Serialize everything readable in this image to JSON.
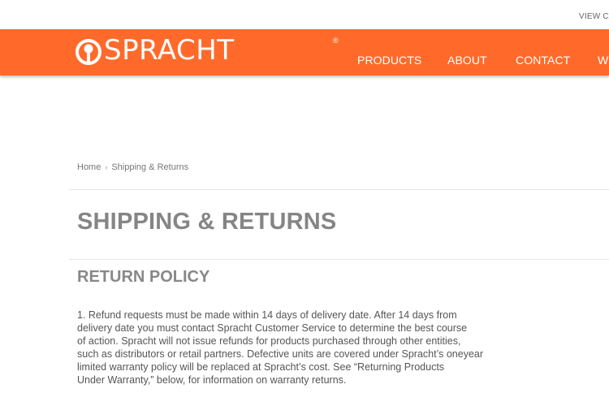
{
  "topbar": {
    "view_cart_label": "VIEW CA"
  },
  "brand": {
    "name": "SPRACHT",
    "registered_mark": "®"
  },
  "nav": {
    "items": [
      "PRODUCTS",
      "ABOUT",
      "CONTACT",
      "W"
    ]
  },
  "breadcrumb": {
    "home": "Home",
    "separator": "›",
    "current": "Shipping & Returns"
  },
  "page": {
    "title": "SHIPPING & RETURNS",
    "section_title": "RETURN POLICY",
    "paragraph_lines": [
      "1. Refund requests must be made within 14 days of delivery date. After 14 days from",
      "delivery date you must contact Spracht Customer Service to determine the best course",
      "of action. Spracht will not issue refunds for products purchased through other entities,",
      "such as distributors or retail partners. Defective units are covered under Spracht’s oneyear",
      "limited warranty policy will be replaced at Spracht’s cost. See “Returning Products",
      "Under Warranty,” below, for information on warranty returns."
    ]
  },
  "colors": {
    "brand_orange": "#ff6a2a",
    "heading_gray": "#858585",
    "text_gray": "#555555"
  }
}
